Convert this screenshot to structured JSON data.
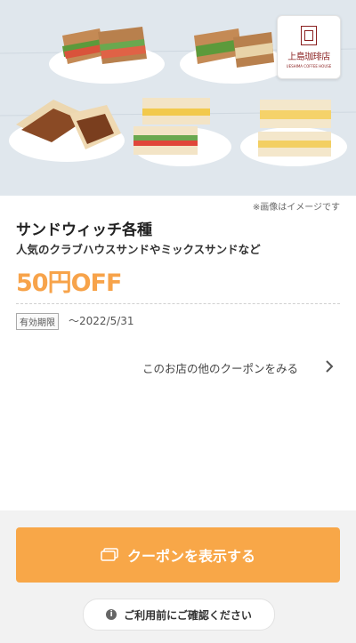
{
  "hero": {
    "logo_text": "上島珈琲店",
    "logo_subtext": "UESHIMA COFFEE HOUSE"
  },
  "coupon": {
    "image_note": "※画像はイメージです",
    "title": "サンドウィッチ各種",
    "description": "人気のクラブハウスサンドやミックスサンドなど",
    "discount": "50円OFF",
    "expiry_label": "有効期限",
    "expiry_date": "〜2022/5/31"
  },
  "links": {
    "other_coupons": "このお店の他のクーポンをみる"
  },
  "footer": {
    "show_coupon_button": "クーポンを表示する",
    "confirm_before_use": "ご利用前にご確認ください"
  },
  "icons": {
    "coupon": "coupon-card-icon",
    "chevron": "chevron-right-icon",
    "info": "info-icon"
  },
  "colors": {
    "accent": "#f8a748",
    "discount": "#f7a34a",
    "footer_bg": "#f2f2f2"
  }
}
